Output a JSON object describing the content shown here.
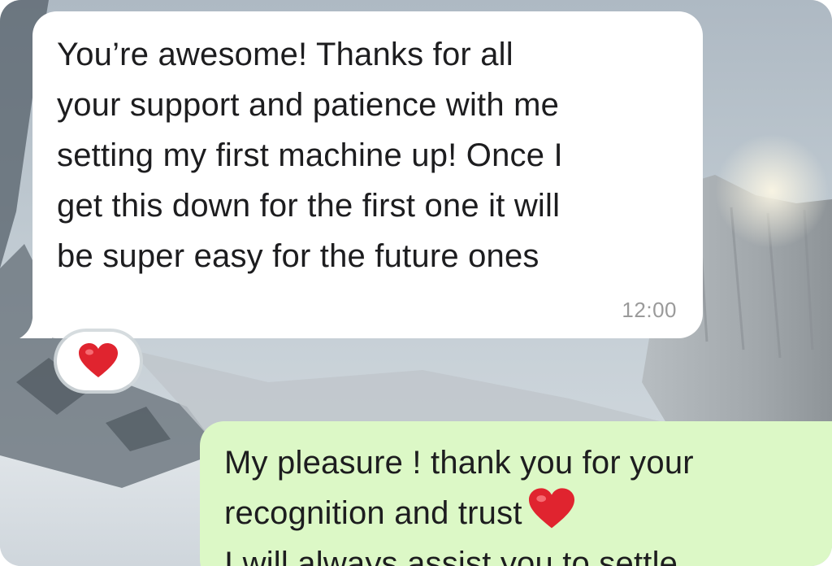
{
  "chat": {
    "colors": {
      "incoming_bubble": "#ffffff",
      "outgoing_bubble": "#dcf8c6",
      "timestamp": "#9a9a9a",
      "heart": "#e0242f"
    },
    "messages": [
      {
        "direction": "incoming",
        "text": "You’re awesome! Thanks for all\nyour support and patience with me\nsetting my first machine up! Once I\nget this down for the first one it will\nbe super easy for the future ones",
        "time": "12:00",
        "reaction": "heart-icon"
      },
      {
        "direction": "outgoing",
        "line1": "My pleasure ! thank you for your",
        "line2": "recognition and trust",
        "line2_icon": "heart-icon",
        "line3": "I will always assist you to settle"
      }
    ]
  }
}
